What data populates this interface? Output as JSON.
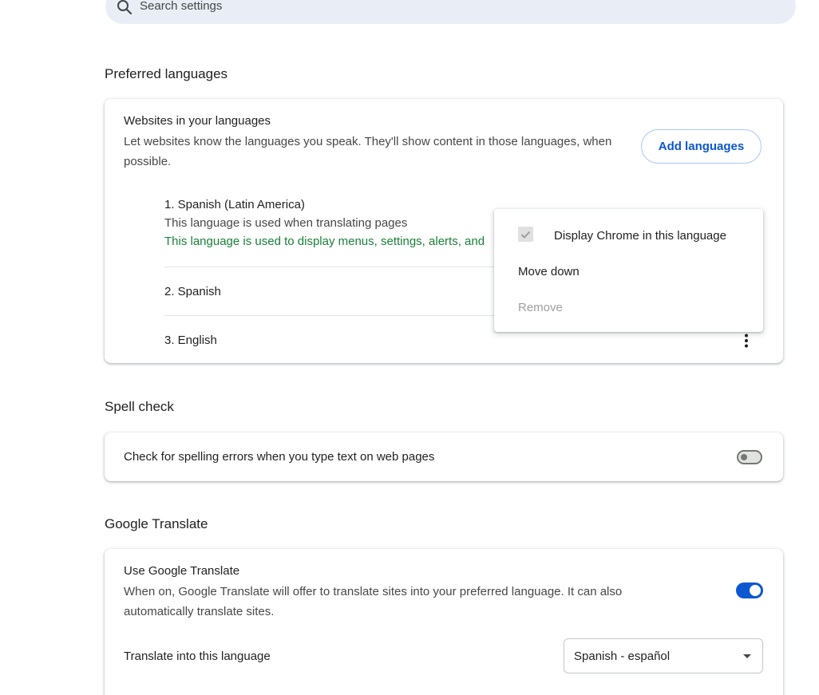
{
  "search": {
    "placeholder": "Search settings",
    "icon": "search-icon"
  },
  "preferred_languages": {
    "section_title": "Preferred languages",
    "heading": "Websites in your languages",
    "description": "Let websites know the languages you speak. They'll show content in those languages, when possible.",
    "add_button": "Add languages",
    "languages": [
      {
        "name": "1. Spanish (Latin America)",
        "note": "This language is used when translating pages",
        "ui_note": "This language is used to display menus, settings, alerts, and"
      },
      {
        "name": "2. Spanish"
      },
      {
        "name": "3. English"
      }
    ]
  },
  "context_menu": {
    "items": [
      {
        "label": "Display Chrome in this language",
        "checked": true,
        "disabled": false
      },
      {
        "label": "Move down",
        "disabled": false
      },
      {
        "label": "Remove",
        "disabled": true
      }
    ]
  },
  "spell_check": {
    "section_title": "Spell check",
    "label": "Check for spelling errors when you type text on web pages",
    "enabled": false
  },
  "google_translate": {
    "section_title": "Google Translate",
    "heading": "Use Google Translate",
    "description": "When on, Google Translate will offer to translate sites into your preferred language. It can also automatically translate sites.",
    "enabled": true,
    "into_label": "Translate into this language",
    "selected_language": "Spanish - español"
  },
  "colors": {
    "accent": "#0b57d0",
    "green_note": "#188038",
    "search_bg": "#e9eef6"
  }
}
